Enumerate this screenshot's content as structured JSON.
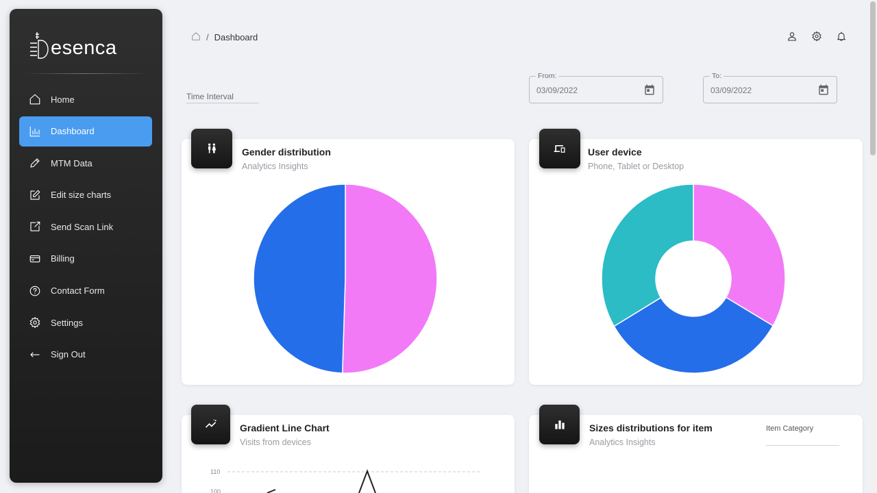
{
  "brand": {
    "logo_text": "esenca"
  },
  "sidebar": {
    "items": [
      {
        "label": "Home",
        "icon": "home-icon",
        "active": false
      },
      {
        "label": "Dashboard",
        "icon": "bar-chart-icon",
        "active": true
      },
      {
        "label": "MTM Data",
        "icon": "pencil-icon",
        "active": false
      },
      {
        "label": "Edit size charts",
        "icon": "edit-icon",
        "active": false
      },
      {
        "label": "Send Scan Link",
        "icon": "send-link-icon",
        "active": false
      },
      {
        "label": "Billing",
        "icon": "card-icon",
        "active": false
      },
      {
        "label": "Contact Form",
        "icon": "help-icon",
        "active": false
      },
      {
        "label": "Settings",
        "icon": "gear-icon",
        "active": false
      },
      {
        "label": "Sign Out",
        "icon": "sign-out-icon",
        "active": false
      }
    ]
  },
  "header": {
    "breadcrumb": "Dashboard",
    "breadcrumb_sep": "/"
  },
  "filters": {
    "interval_label": "Time Interval",
    "from_label": "From:",
    "from_value": "03/09/2022",
    "to_label": "To:",
    "to_value": "03/09/2022"
  },
  "cards": {
    "gender": {
      "title": "Gender distribution",
      "subtitle": "Analytics Insights"
    },
    "device": {
      "title": "User device",
      "subtitle": "Phone, Tablet or Desktop"
    },
    "line": {
      "title": "Gradient Line Chart",
      "subtitle": "Visits from devices"
    },
    "sizes": {
      "title": "Sizes distributions for item",
      "subtitle": "Analytics Insights",
      "category_label": "Item Category"
    }
  },
  "colors": {
    "pink": "#f27af7",
    "blue": "#246ee9",
    "teal": "#2bbcc5",
    "accent": "#4a9cf0"
  },
  "chart_data": [
    {
      "type": "pie",
      "title": "Gender distribution",
      "slices": [
        {
          "value": 50.5,
          "color": "#f27af7"
        },
        {
          "value": 49.5,
          "color": "#246ee9"
        }
      ]
    },
    {
      "type": "pie",
      "variant": "doughnut",
      "title": "User device",
      "slices": [
        {
          "value": 33.3,
          "color": "#f27af7"
        },
        {
          "value": 33.3,
          "color": "#246ee9"
        },
        {
          "value": 33.4,
          "color": "#2bbcc5"
        }
      ]
    },
    {
      "type": "line",
      "title": "Gradient Line Chart",
      "tick_labels": [
        "110",
        "100"
      ]
    }
  ]
}
